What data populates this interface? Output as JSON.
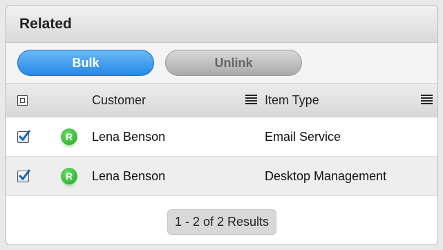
{
  "panel": {
    "title": "Related"
  },
  "toolbar": {
    "bulk_label": "Bulk",
    "unlink_label": "Unlink"
  },
  "table": {
    "columns": {
      "customer": "Customer",
      "item_type": "Item Type"
    },
    "rows": [
      {
        "badge": "R",
        "customer": "Lena Benson",
        "item_type": "Email Service",
        "checked": true
      },
      {
        "badge": "R",
        "customer": "Lena Benson",
        "item_type": "Desktop Management",
        "checked": true
      }
    ]
  },
  "pagination": {
    "summary": "1 - 2 of 2 Results"
  },
  "colors": {
    "accent": "#2688e6",
    "badge": "#1ea51e"
  }
}
